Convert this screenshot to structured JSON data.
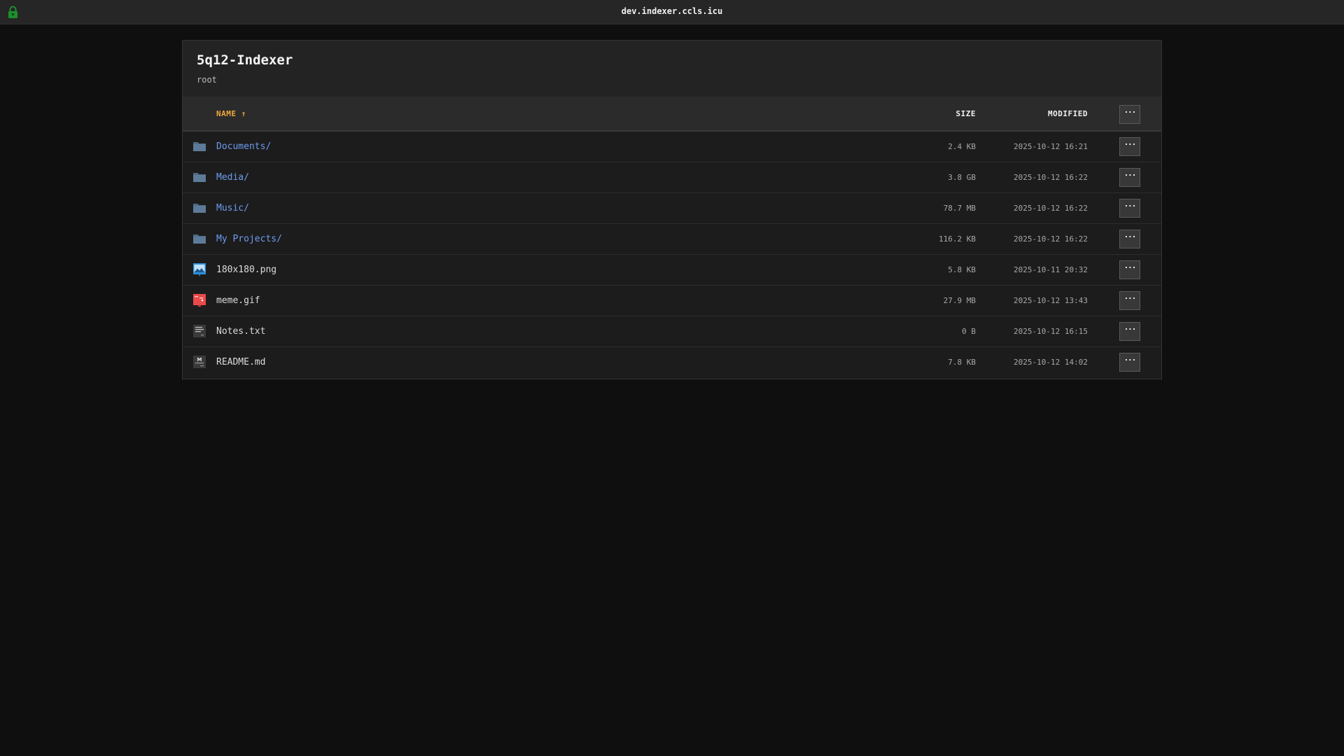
{
  "topbar": {
    "title": "dev.indexer.ccls.icu",
    "lock_icon": "lock-icon",
    "lock_color": "#1e8e2e"
  },
  "panel": {
    "title": "5q12-Indexer",
    "path": "root"
  },
  "table": {
    "headers": {
      "name": "NAME ↑",
      "size": "SIZE",
      "modified": "MODIFIED",
      "actions": "···"
    },
    "rows": [
      {
        "name": "Documents/",
        "type": "folder",
        "icon": "folder-icon",
        "size": "2.4 KB",
        "modified": "2025-10-12 16:21",
        "actions": "···"
      },
      {
        "name": "Media/",
        "type": "folder",
        "icon": "folder-icon",
        "size": "3.8 GB",
        "modified": "2025-10-12 16:22",
        "actions": "···"
      },
      {
        "name": "Music/",
        "type": "folder",
        "icon": "folder-icon",
        "size": "78.7 MB",
        "modified": "2025-10-12 16:22",
        "actions": "···"
      },
      {
        "name": "My Projects/",
        "type": "folder",
        "icon": "folder-icon",
        "size": "116.2 KB",
        "modified": "2025-10-12 16:22",
        "actions": "···"
      },
      {
        "name": "180x180.png",
        "type": "png",
        "icon": "image-file-icon",
        "size": "5.8 KB",
        "modified": "2025-10-11 20:32",
        "actions": "···"
      },
      {
        "name": "meme.gif",
        "type": "gif",
        "icon": "gif-file-icon",
        "size": "27.9 MB",
        "modified": "2025-10-12 13:43",
        "actions": "···"
      },
      {
        "name": "Notes.txt",
        "type": "txt",
        "icon": "text-file-icon",
        "size": "0 B",
        "modified": "2025-10-12 16:15",
        "actions": "···"
      },
      {
        "name": "README.md",
        "type": "md",
        "icon": "markdown-file-icon",
        "size": "7.8 KB",
        "modified": "2025-10-12 14:02",
        "actions": "···"
      }
    ]
  },
  "colors": {
    "background": "#0f0f0f",
    "folder_link": "#6e9cf0",
    "sort_header": "#f0a93a"
  }
}
